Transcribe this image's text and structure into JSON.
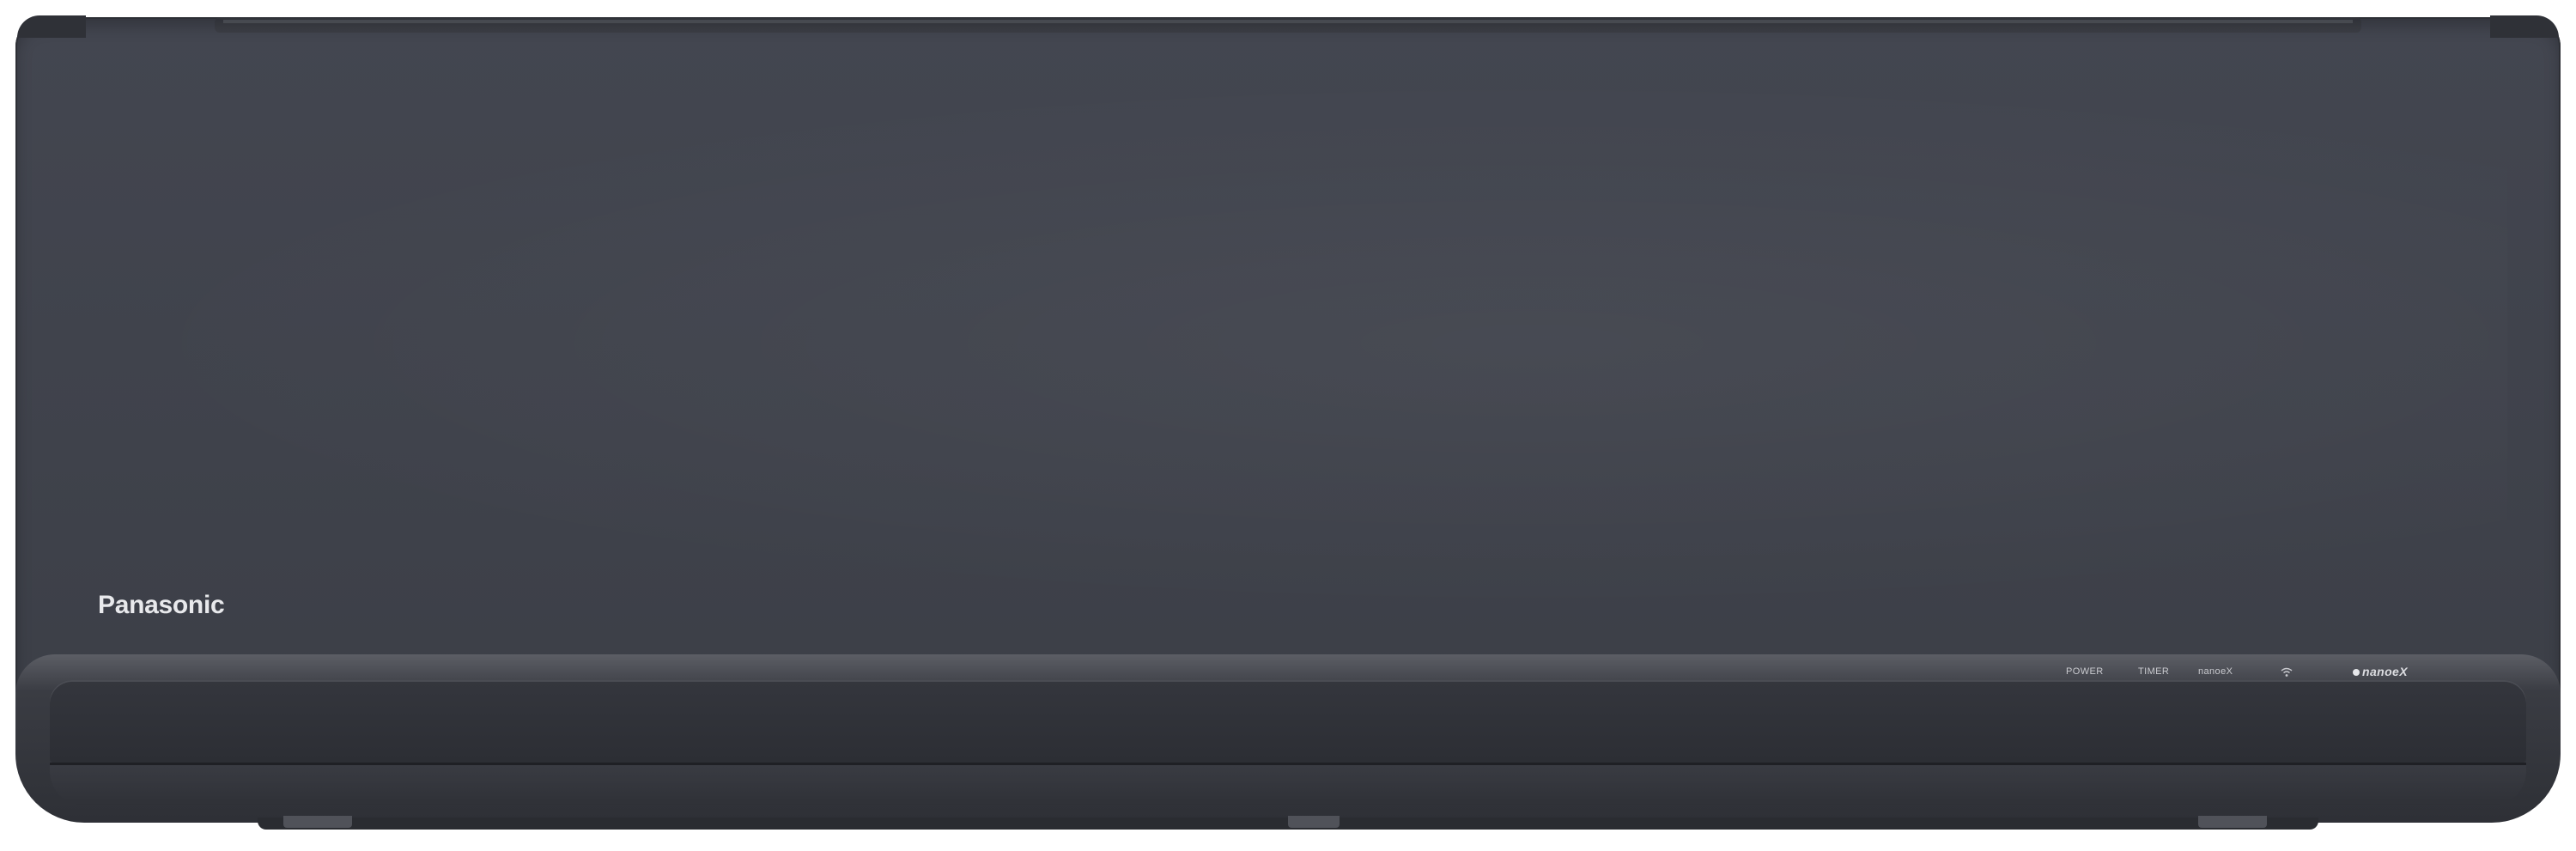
{
  "product": {
    "brand": "Panasonic",
    "indicators": {
      "power_label": "POWER",
      "timer_label": "TIMER",
      "nanoe_label": "nanoeX",
      "wifi_icon": "wifi-icon"
    },
    "nanoe_logo_text": "nanoeX"
  },
  "colors": {
    "body": "#3f424b",
    "louver": "#2e3036",
    "logo_text": "#e8e9ec"
  }
}
